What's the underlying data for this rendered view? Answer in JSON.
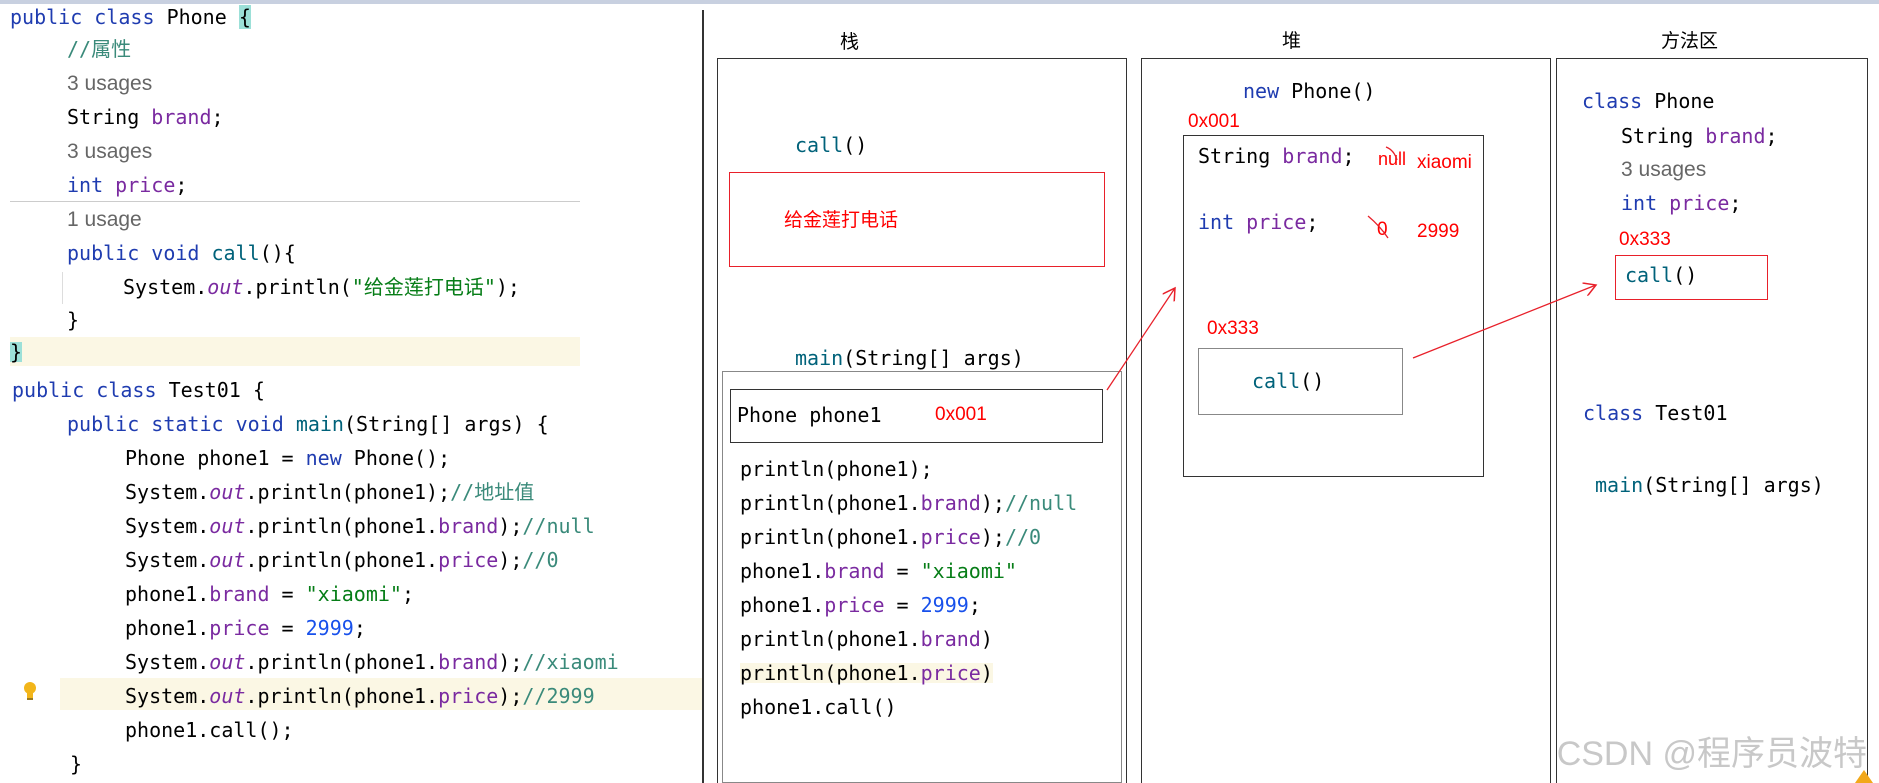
{
  "code": {
    "class_phone": {
      "kw1": "public",
      "kw2": "class",
      "name": "Phone",
      "brace": "{"
    },
    "comment_attr": "//属性",
    "usage_brand": "3 usages",
    "field_brand": {
      "type": "String",
      "name": "brand",
      "semi": ";"
    },
    "usage_price": "3 usages",
    "field_price": {
      "type": "int",
      "name": "price",
      "semi": ";"
    },
    "usage_call": "1 usage",
    "method_call": {
      "kw1": "public",
      "kw2": "void",
      "name": "call",
      "rest": "(){"
    },
    "call_body": {
      "obj": "System.",
      "out": "out",
      "rest": ".println(",
      "str": "\"给金莲打电话\"",
      "end": ");"
    },
    "close_method": "}",
    "close_class": "}",
    "class_test": {
      "kw1": "public",
      "kw2": "class",
      "name": "Test01",
      "brace": "{"
    },
    "main_sig": {
      "kw1": "public",
      "kw2": "static",
      "kw3": "void",
      "name": "main",
      "rest": "(String[] args) {"
    },
    "line_new": {
      "a": "Phone phone1 = ",
      "kw": "new",
      "b": " Phone();"
    },
    "line_p1": {
      "obj": "System.",
      "out": "out",
      "rest": ".println(phone1);",
      "cmt": "//地址值"
    },
    "line_p2": {
      "obj": "System.",
      "out": "out",
      "a": ".println(phone1.",
      "fld": "brand",
      "b": ");",
      "cmt": "//null"
    },
    "line_p3": {
      "obj": "System.",
      "out": "out",
      "a": ".println(phone1.",
      "fld": "price",
      "b": ");",
      "cmt": "//0"
    },
    "line_a1": {
      "a": "phone1.",
      "fld": "brand",
      "b": " = ",
      "str": "\"xiaomi\"",
      "c": ";"
    },
    "line_a2": {
      "a": "phone1.",
      "fld": "price",
      "b": " = ",
      "num": "2999",
      "c": ";"
    },
    "line_p4": {
      "obj": "System.",
      "out": "out",
      "a": ".println(phone1.",
      "fld": "brand",
      "b": ");",
      "cmt": "//xiaomi"
    },
    "line_p5": {
      "obj": "System.",
      "out": "out",
      "a": ".println(phone1.",
      "fld": "price",
      "b": ");",
      "cmt": "//2999"
    },
    "line_call": "phone1.call();",
    "close_main": "}"
  },
  "headers": {
    "stack": "栈",
    "heap": "堆",
    "method_area": "方法区"
  },
  "stack": {
    "call_frame": {
      "fn": "call",
      "rest": "()"
    },
    "call_msg": "给金莲打电话",
    "main_frame": {
      "fn": "main",
      "rest": "(String[] args)"
    },
    "phone_var": "Phone phone1",
    "phone_addr": "0x001",
    "lines": [
      {
        "a": "println(phone1);"
      },
      {
        "a": "println(phone1.",
        "fld": "brand",
        "b": ");",
        "cmt": "//null"
      },
      {
        "a": "println(phone1.",
        "fld": "price",
        "b": ");",
        "cmt": "//0"
      },
      {
        "a": "phone1.",
        "fld": "brand",
        "b": " = ",
        "str": "\"xiaomi\""
      },
      {
        "a": "phone1.",
        "fld": "price",
        "b": " = ",
        "num": "2999",
        "c": ";"
      },
      {
        "a": "println(phone1.",
        "fld": "brand",
        "b": ")"
      },
      {
        "a": "println(phone1.",
        "fld": "price",
        "b": ")"
      },
      {
        "a": "phone1.call()"
      }
    ]
  },
  "heap": {
    "new_kw": "new",
    "new_rest": " Phone()",
    "obj_addr": "0x001",
    "brand_line": {
      "type": "String",
      "fld": "brand",
      "semi": ";"
    },
    "brand_old": "null",
    "brand_new": "xiaomi",
    "price_line": {
      "type": "int",
      "fld": "price",
      "semi": ";"
    },
    "price_old": "0",
    "price_new": "2999",
    "method_addr": "0x333",
    "call": {
      "fn": "call",
      "rest": "()"
    }
  },
  "method_area": {
    "class_phone": {
      "kw": "class",
      "name": " Phone"
    },
    "brand_line": {
      "type": "String ",
      "fld": "brand",
      "semi": ";"
    },
    "usages": "3 usages",
    "price_line": {
      "type": "int ",
      "fld": "price",
      "semi": ";"
    },
    "call_addr": "0x333",
    "call": {
      "fn": "call",
      "rest": "()"
    },
    "class_test": {
      "kw": "class",
      "name": " Test01"
    },
    "main": {
      "fn": "main",
      "rest": "(String[] args)"
    }
  },
  "watermark": "CSDN @程序员波特"
}
